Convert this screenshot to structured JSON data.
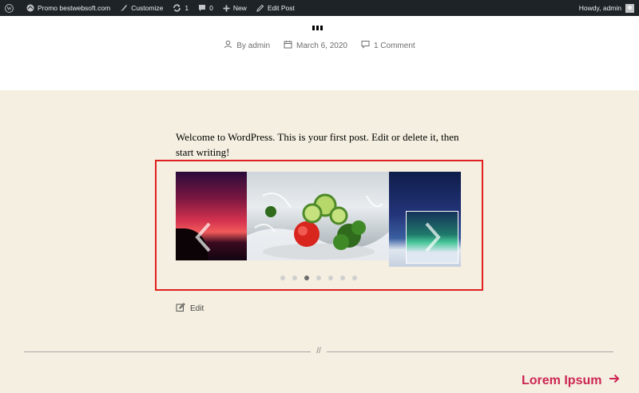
{
  "adminbar": {
    "site_name": "Promo bestwebsoft.com",
    "customize": "Customize",
    "updates_count": "1",
    "comments_count": "0",
    "new": "New",
    "edit_post": "Edit Post",
    "howdy": "Howdy, admin"
  },
  "post": {
    "author": "By admin",
    "date": "March 6, 2020",
    "comments": "1 Comment",
    "intro": "Welcome to WordPress. This is your first post. Edit or delete it, then start writing!",
    "edit": "Edit"
  },
  "slider": {
    "slides": [
      "sunset-image",
      "vegetables-splash-image",
      "aurora-image"
    ],
    "dot_count": 7,
    "active_dot": 2
  },
  "divider_mark": "//",
  "next_post": {
    "label": "Lorem Ipsum"
  },
  "colors": {
    "admin_bar": "#1d2327",
    "page_bg": "#f4efe0",
    "accent": "#cd2653",
    "highlight": "#e02020"
  }
}
